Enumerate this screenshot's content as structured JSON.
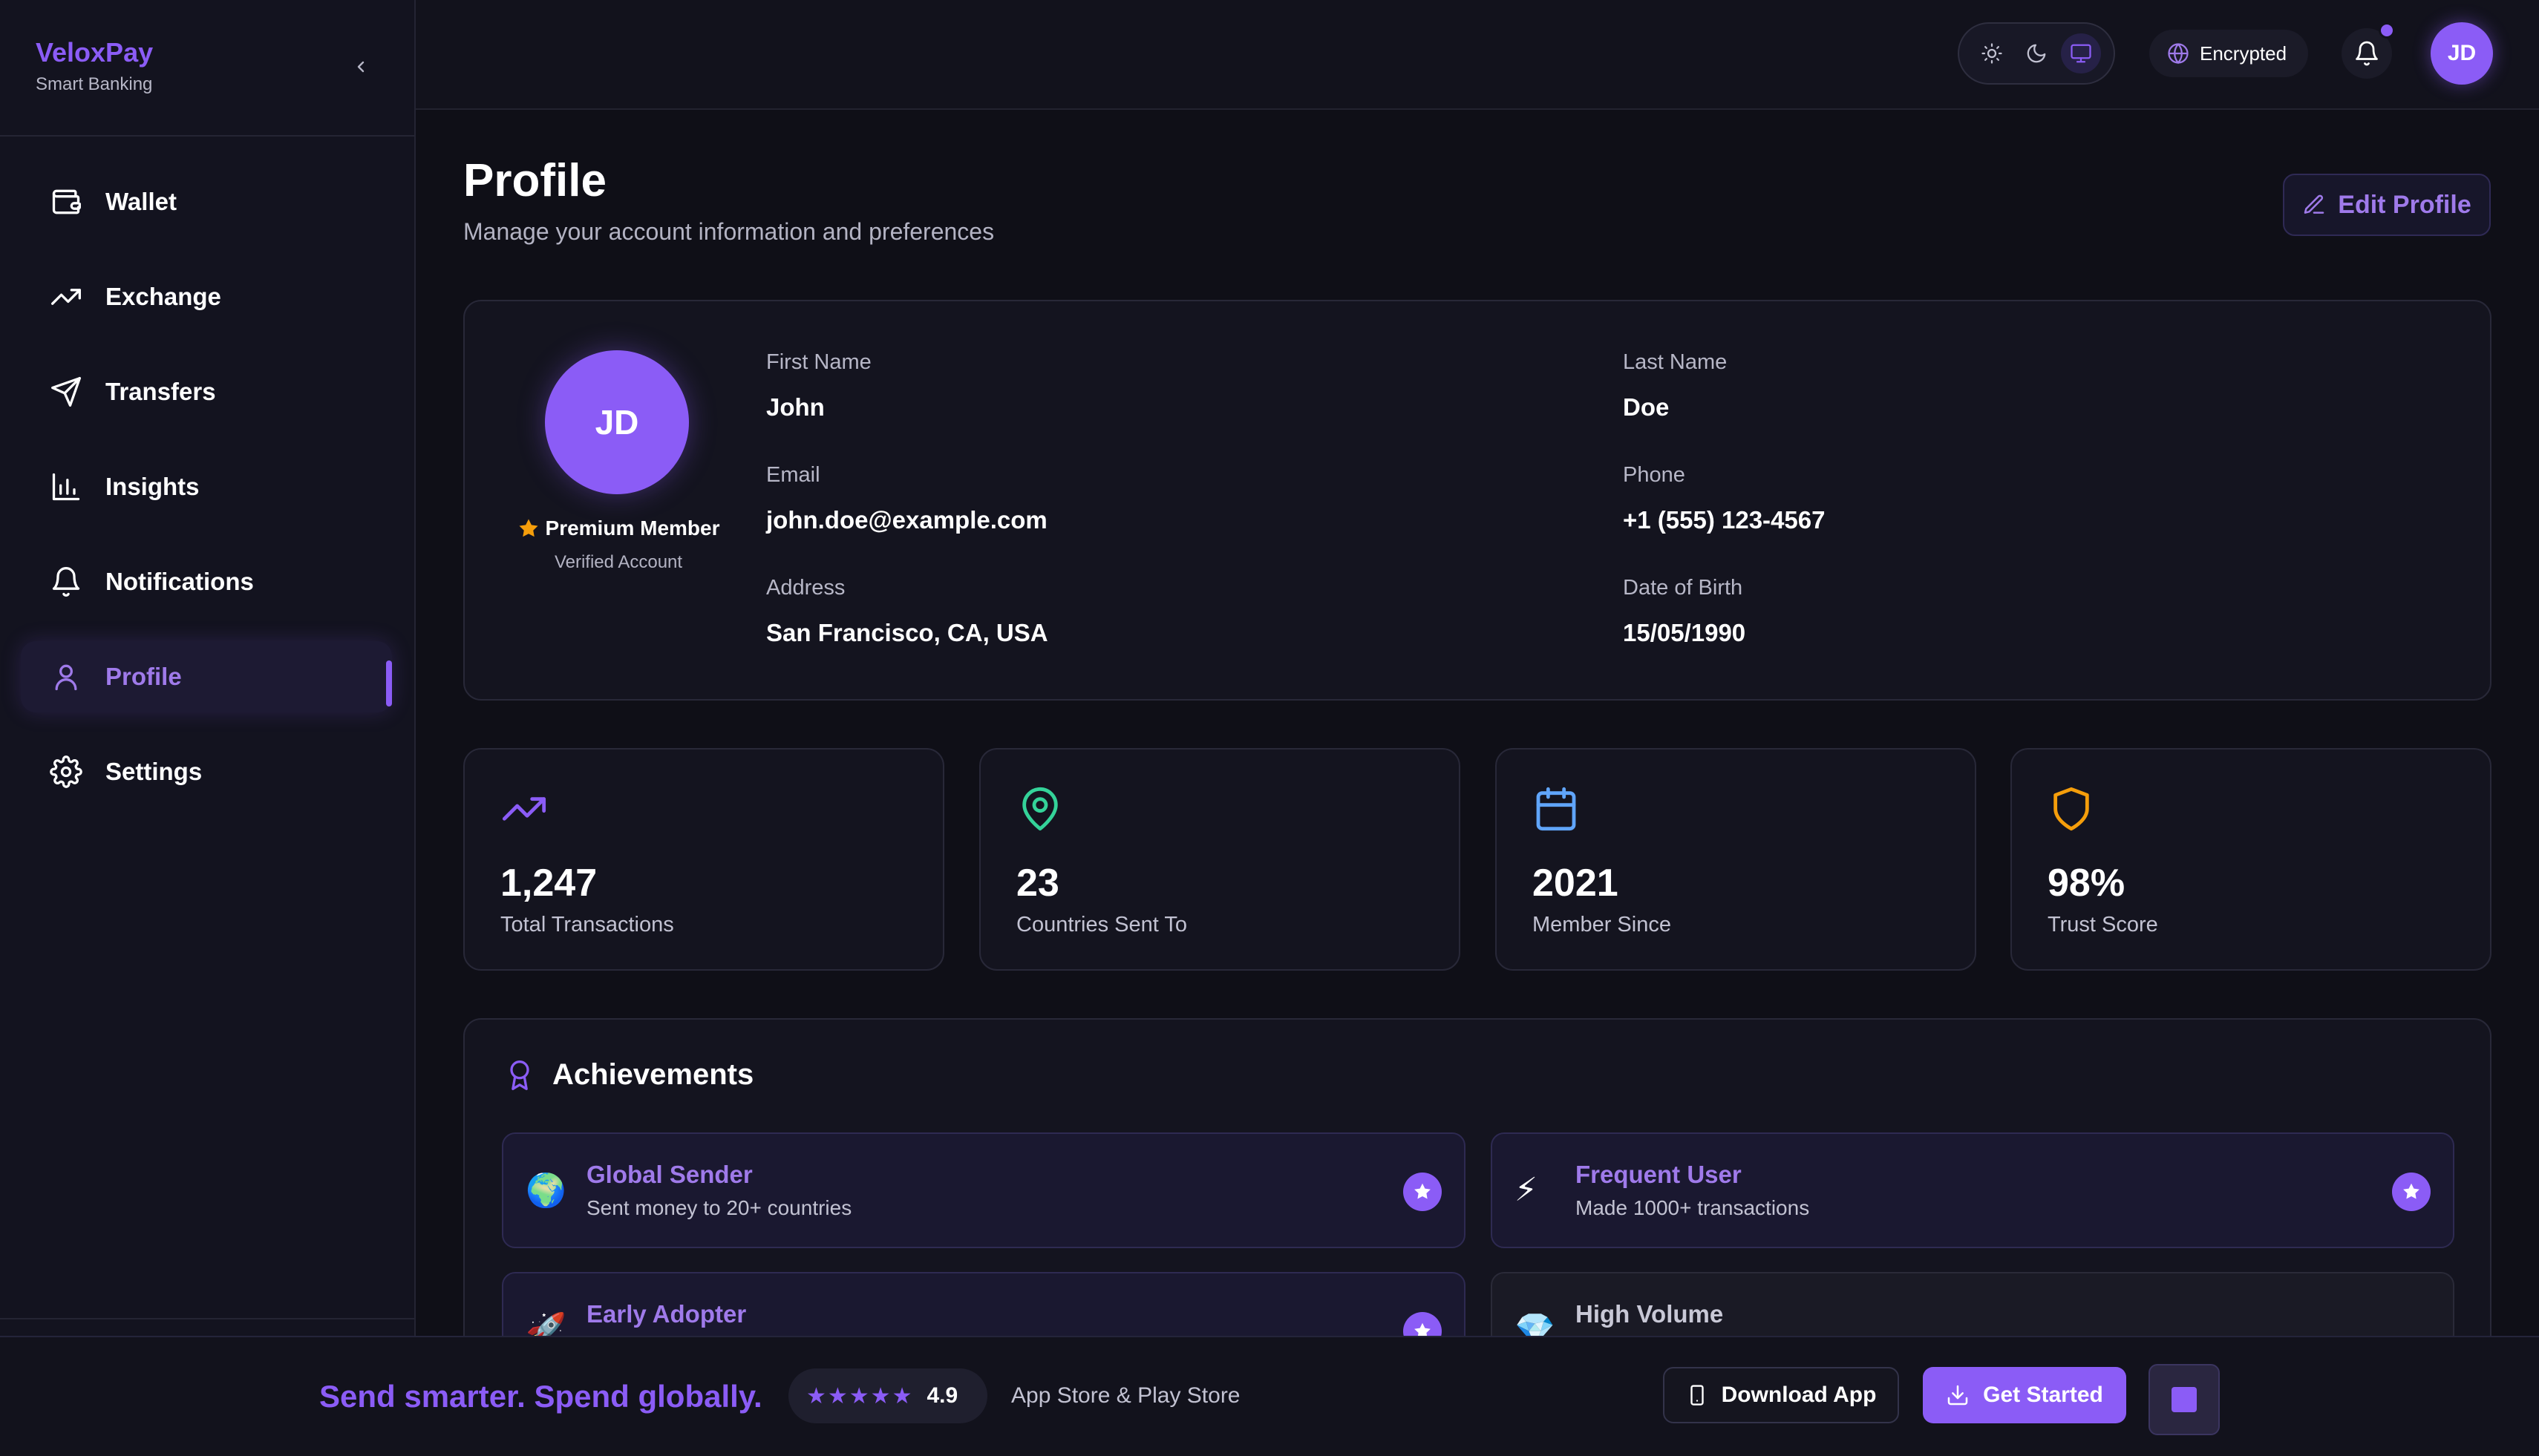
{
  "brand": {
    "name": "VeloxPay",
    "subtitle": "Smart Banking"
  },
  "sidebar": {
    "items": [
      {
        "label": "Wallet",
        "icon": "wallet-icon",
        "active": false
      },
      {
        "label": "Exchange",
        "icon": "trending-up-icon",
        "active": false
      },
      {
        "label": "Transfers",
        "icon": "send-icon",
        "active": false
      },
      {
        "label": "Insights",
        "icon": "bar-chart-icon",
        "active": false
      },
      {
        "label": "Notifications",
        "icon": "bell-icon",
        "active": false
      },
      {
        "label": "Profile",
        "icon": "user-icon",
        "active": true
      },
      {
        "label": "Settings",
        "icon": "gear-icon",
        "active": false
      }
    ]
  },
  "topbar": {
    "theme_options": [
      "sun-icon",
      "moon-icon",
      "monitor-icon"
    ],
    "theme_selected": "monitor-icon",
    "encrypted_label": "Encrypted",
    "avatar_initials": "JD",
    "has_notification": true
  },
  "page": {
    "title": "Profile",
    "subtitle": "Manage your account information and preferences",
    "edit_label": "Edit Profile"
  },
  "profile": {
    "initials": "JD",
    "membership": "Premium Member",
    "verification": "Verified Account",
    "fields": {
      "first_name": {
        "label": "First Name",
        "value": "John"
      },
      "last_name": {
        "label": "Last Name",
        "value": "Doe"
      },
      "email": {
        "label": "Email",
        "value": "john.doe@example.com"
      },
      "phone": {
        "label": "Phone",
        "value": "+1 (555) 123-4567"
      },
      "address": {
        "label": "Address",
        "value": "San Francisco, CA, USA"
      },
      "dob": {
        "label": "Date of Birth",
        "value": "15/05/1990"
      }
    }
  },
  "stats": [
    {
      "value": "1,247",
      "label": "Total Transactions",
      "icon": "trending-up-icon",
      "color": "#8b5cf6"
    },
    {
      "value": "23",
      "label": "Countries Sent To",
      "icon": "map-pin-icon",
      "color": "#34d399"
    },
    {
      "value": "2021",
      "label": "Member Since",
      "icon": "calendar-icon",
      "color": "#60a5fa"
    },
    {
      "value": "98%",
      "label": "Trust Score",
      "icon": "shield-icon",
      "color": "#f59e0b"
    }
  ],
  "achievements": {
    "title": "Achievements",
    "items": [
      {
        "emoji": "🌍",
        "title": "Global Sender",
        "desc": "Sent money to 20+ countries",
        "unlocked": true
      },
      {
        "emoji": "⚡",
        "title": "Frequent User",
        "desc": "Made 1000+ transactions",
        "unlocked": true
      },
      {
        "emoji": "🚀",
        "title": "Early Adopter",
        "desc": "",
        "unlocked": true
      },
      {
        "emoji": "💎",
        "title": "High Volume",
        "desc": "",
        "unlocked": false
      }
    ]
  },
  "footer": {
    "tagline": "Send smarter. Spend globally.",
    "stars": "★★★★★",
    "rating": "4.9",
    "stores": "App Store & Play Store",
    "download_label": "Download App",
    "cta_label": "Get Started"
  },
  "colors": {
    "accent": "#8b5cf6",
    "background": "#0f0f17",
    "card": "#14141f"
  }
}
